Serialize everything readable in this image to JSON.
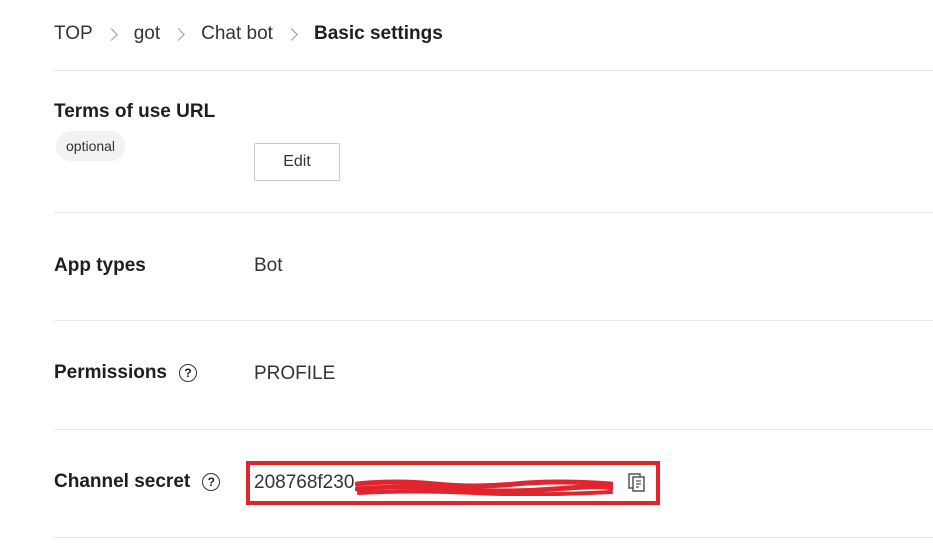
{
  "breadcrumb": {
    "items": [
      "TOP",
      "got",
      "Chat bot"
    ],
    "current": "Basic settings"
  },
  "terms": {
    "label": "Terms of use URL",
    "badge": "optional",
    "edit_label": "Edit"
  },
  "app_types": {
    "label": "App types",
    "value": "Bot"
  },
  "permissions": {
    "label": "Permissions",
    "value": "PROFILE"
  },
  "channel_secret": {
    "label": "Channel secret",
    "visible_prefix": "208768f230"
  },
  "colors": {
    "highlight_box": "#e0252f",
    "redaction": "#e0252f",
    "divider": "#e6e6e6"
  },
  "icons": {
    "breadcrumb_separator": "chevron-right-icon",
    "help": "question-circle-icon",
    "copy": "copy-icon"
  }
}
